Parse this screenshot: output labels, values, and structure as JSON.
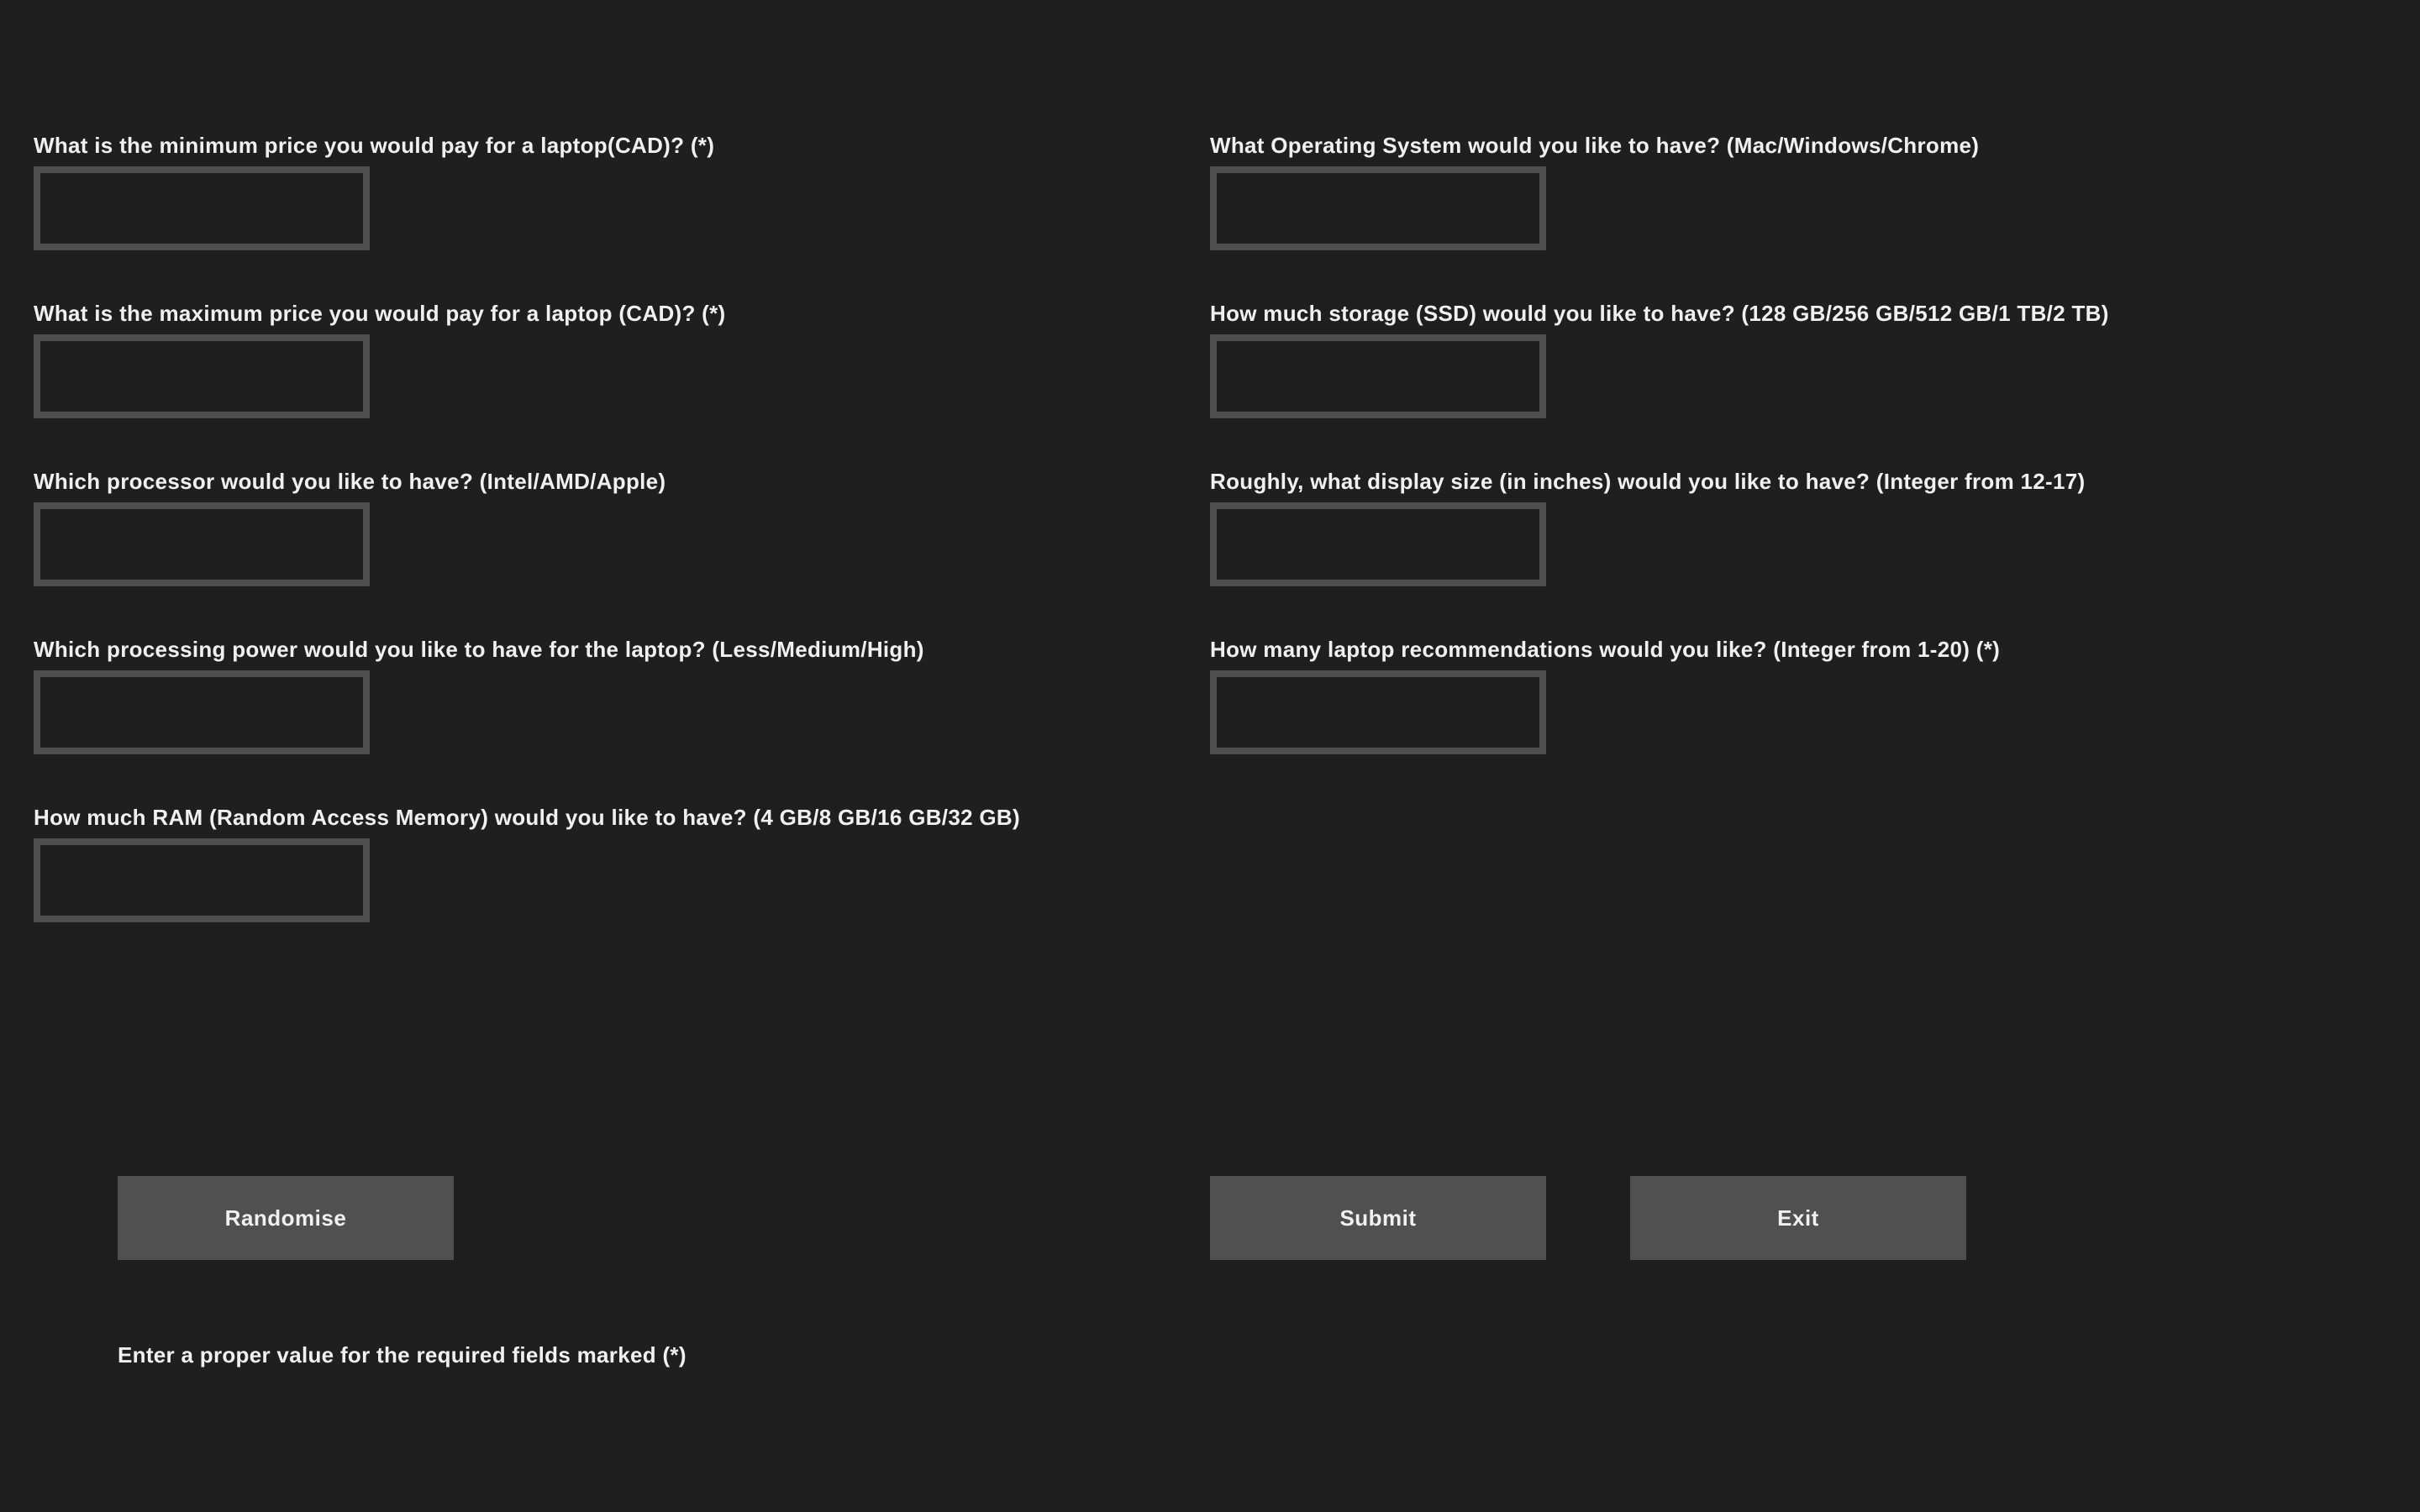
{
  "form": {
    "left_fields": [
      {
        "label": "What is the minimum price you would pay for a laptop(CAD)? (*)",
        "value": ""
      },
      {
        "label": "What is the maximum price you would pay for a laptop (CAD)? (*)",
        "value": ""
      },
      {
        "label": "Which processor would you like to have? (Intel/AMD/Apple)",
        "value": ""
      },
      {
        "label": "Which processing power would you like to have for the laptop? (Less/Medium/High)",
        "value": ""
      },
      {
        "label": "How much RAM (Random Access Memory) would you like to have? (4 GB/8 GB/16 GB/32 GB)",
        "value": ""
      }
    ],
    "right_fields": [
      {
        "label": "What Operating System would you like to have? (Mac/Windows/Chrome)",
        "value": ""
      },
      {
        "label": "How much storage (SSD) would you like to have? (128 GB/256 GB/512 GB/1 TB/2 TB)",
        "value": ""
      },
      {
        "label": "Roughly, what display size (in inches) would you like to have? (Integer from 12-17)",
        "value": ""
      },
      {
        "label": "How many laptop recommendations would you like? (Integer from 1-20) (*)",
        "value": ""
      }
    ]
  },
  "buttons": {
    "randomise_label": "Randomise",
    "submit_label": "Submit",
    "exit_label": "Exit"
  },
  "status": {
    "message": "Enter a proper value for the required fields marked (*)"
  },
  "colors": {
    "background": "#1f1f1f",
    "input_border": "#4f4f4f",
    "button": "#505050",
    "text": "#f0f0f0"
  }
}
